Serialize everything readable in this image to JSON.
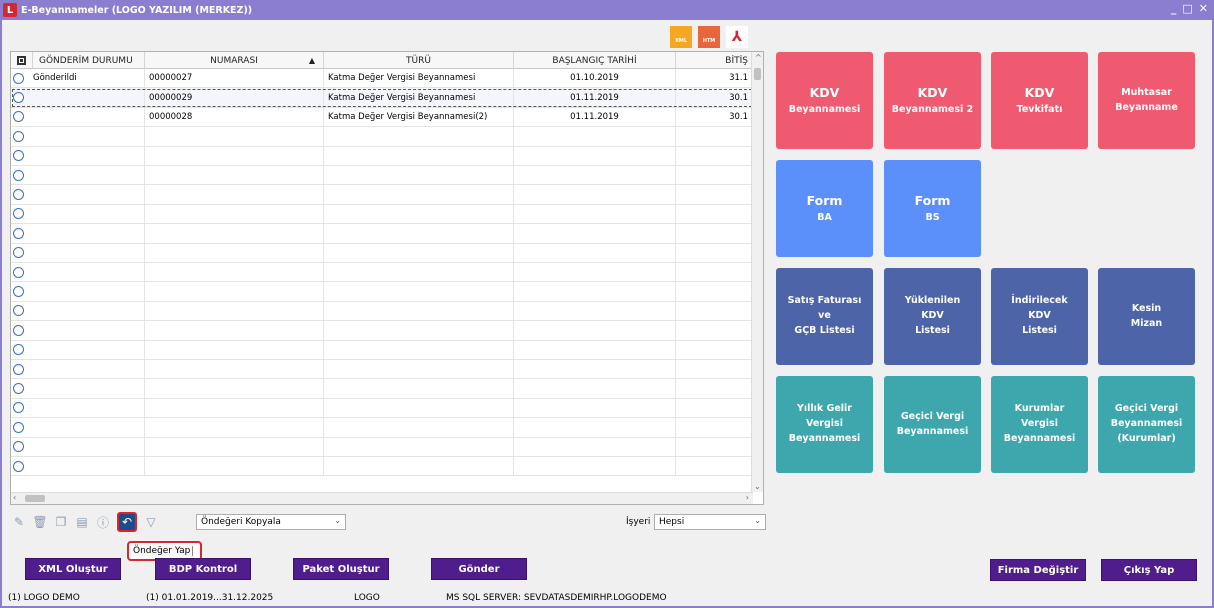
{
  "window": {
    "title": "E-Beyannameler (LOGO YAZILIM (MERKEZ))",
    "controls": [
      "_",
      "□",
      "✕"
    ]
  },
  "file_icons": [
    {
      "name": "xml-icon",
      "label": "XML"
    },
    {
      "name": "htm-icon",
      "label": "HTM"
    },
    {
      "name": "pdf-icon",
      "label": "⅄"
    }
  ],
  "grid": {
    "columns": [
      "GÖNDERİM DURUMU",
      "NUMARASI",
      "TÜRÜ",
      "BAŞLANGIÇ TARİHİ",
      "BİTİŞ"
    ],
    "rows": [
      {
        "status": "Gönderildi",
        "number": "00000027",
        "type": "Katma Değer Vergisi Beyannamesi",
        "start": "01.10.2019",
        "end": "31.1"
      },
      {
        "status": "",
        "number": "00000029",
        "type": "Katma Değer Vergisi Beyannamesi",
        "start": "01.11.2019",
        "end": "30.1"
      },
      {
        "status": "",
        "number": "00000028",
        "type": "Katma Değer Vergisi Beyannamesi(2)",
        "start": "01.11.2019",
        "end": "30.1"
      }
    ]
  },
  "toolbar": {
    "icons": [
      "edit-icon",
      "delete-icon",
      "copy-icon",
      "document-icon",
      "info-icon",
      "default-icon",
      "filter-icon"
    ],
    "copy_dropdown": "Öndeğeri Kopyala",
    "isyeri_label": "İşyeri",
    "isyeri_value": "Hepsi",
    "tooltip": "Öndeğer Yap"
  },
  "buttons": {
    "xml": "XML Oluştur",
    "bdp": "BDP Kontrol",
    "paket": "Paket Oluştur",
    "gonder": "Gönder",
    "firma": "Firma Değiştir",
    "cikis": "Çıkış Yap"
  },
  "tiles": [
    {
      "l1": "KDV",
      "l2": "Beyannamesi",
      "l3": ""
    },
    {
      "l1": "KDV",
      "l2": "Beyannamesi 2",
      "l3": ""
    },
    {
      "l1": "KDV",
      "l2": "Tevkifatı",
      "l3": ""
    },
    {
      "l1": "Muhtasar",
      "l2": "Beyanname",
      "l3": ""
    },
    {
      "l1": "Form",
      "l2": "BA",
      "l3": ""
    },
    {
      "l1": "Form",
      "l2": "BS",
      "l3": ""
    },
    {
      "l1": "Satış Faturası",
      "l2": "ve",
      "l3": "GÇB Listesi"
    },
    {
      "l1": "Yüklenilen",
      "l2": "KDV",
      "l3": "Listesi"
    },
    {
      "l1": "İndirilecek",
      "l2": "KDV",
      "l3": "Listesi"
    },
    {
      "l1": "Kesin",
      "l2": "Mizan",
      "l3": ""
    },
    {
      "l1": "Yıllık Gelir",
      "l2": "Vergisi",
      "l3": "Beyannamesi"
    },
    {
      "l1": "Geçici Vergi",
      "l2": "Beyannamesi",
      "l3": ""
    },
    {
      "l1": "Kurumlar",
      "l2": "Vergisi",
      "l3": "Beyannamesi"
    },
    {
      "l1": "Geçici Vergi",
      "l2": "Beyannamesi",
      "l3": "(Kurumlar)"
    }
  ],
  "status": {
    "firm": "(1) LOGO DEMO",
    "period": "(1) 01.01.2019...31.12.2025",
    "user": "LOGO",
    "server": "MS SQL SERVER: SEVDATASDEMIRHP.LOGODEMO"
  }
}
